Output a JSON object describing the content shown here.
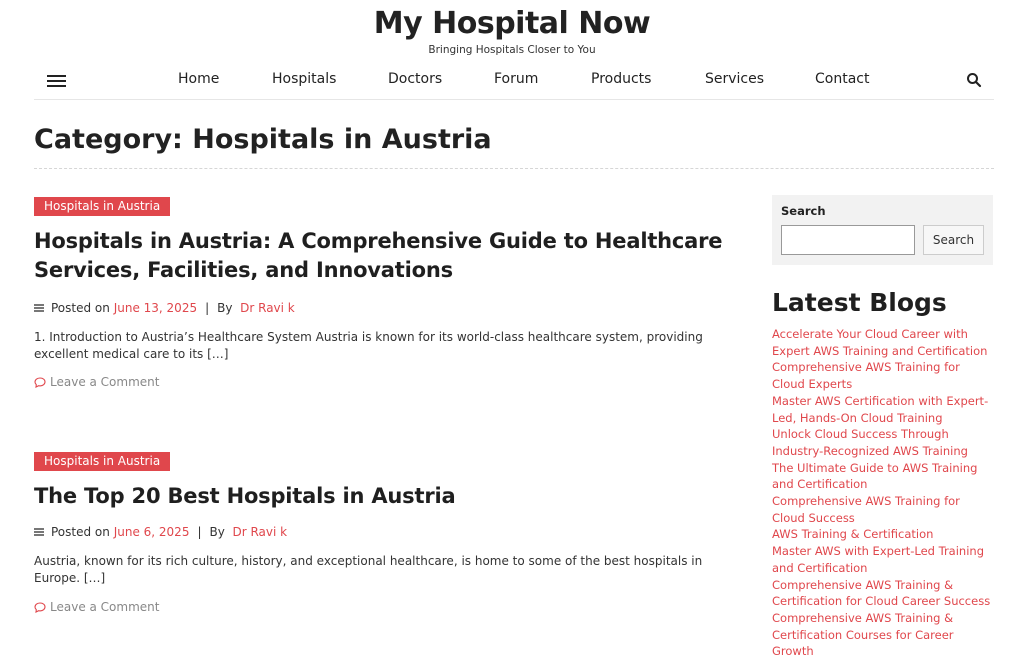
{
  "header": {
    "site_title": "My Hospital Now",
    "tagline": "Bringing Hospitals Closer to You"
  },
  "nav": {
    "items": [
      {
        "label": "Home"
      },
      {
        "label": "Hospitals"
      },
      {
        "label": "Doctors"
      },
      {
        "label": "Forum"
      },
      {
        "label": "Products"
      },
      {
        "label": "Services"
      },
      {
        "label": "Contact"
      }
    ]
  },
  "category": {
    "title": "Category: Hospitals in Austria"
  },
  "posts": [
    {
      "badge": "Hospitals in Austria",
      "title": "Hospitals in Austria: A Comprehensive Guide to Healthcare Services, Facilities, and Innovations",
      "posted_on_label": "Posted on",
      "date": "June 13, 2025",
      "separator": "|",
      "by_label": "By",
      "author": "Dr Ravi k",
      "excerpt": "1. Introduction to Austria’s Healthcare System Austria is known for its world-class healthcare system, providing excellent medical care to its […]",
      "comment": "Leave a Comment"
    },
    {
      "badge": "Hospitals in Austria",
      "title": "The Top 20 Best Hospitals in Austria",
      "posted_on_label": "Posted on",
      "date": "June 6, 2025",
      "separator": "|",
      "by_label": "By",
      "author": "Dr Ravi k",
      "excerpt": "Austria, known for its rich culture, history, and exceptional healthcare, is home to some of the best hospitals in Europe. […]",
      "comment": "Leave a Comment"
    }
  ],
  "sidebar": {
    "search_label": "Search",
    "search_value": "",
    "search_button": "Search",
    "latest_title": "Latest Blogs",
    "latest": [
      "Accelerate Your Cloud Career with Expert AWS Training and Certification",
      "Comprehensive AWS Training for Cloud Experts",
      "Master AWS Certification with Expert-Led, Hands-On Cloud Training",
      "Unlock Cloud Success Through Industry-Recognized AWS Training",
      "The Ultimate Guide to AWS Training and Certification",
      "Comprehensive AWS Training for Cloud Success",
      "AWS Training & Certification",
      "Master AWS with Expert-Led Training and Certification",
      "Comprehensive AWS Training & Certification for Cloud Career Success",
      "Comprehensive AWS Training & Certification Courses for Career Growth"
    ]
  },
  "colors": {
    "accent": "#e0474c",
    "text": "#1f1f1f",
    "sidebar_bg": "#f2f2f2"
  },
  "icons": {
    "menu": "hamburger-icon",
    "search": "search-icon",
    "meta": "list-icon",
    "comment": "comment-icon"
  }
}
